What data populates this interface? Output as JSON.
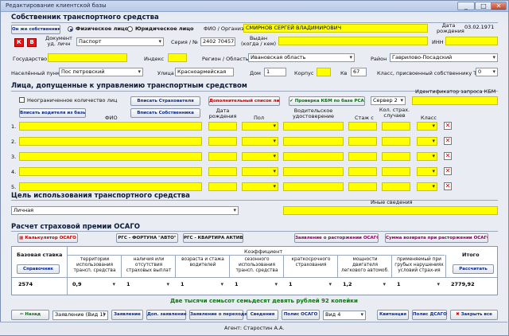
{
  "window": {
    "title": "Редактирование клиентской базы",
    "buttons": [
      "_",
      "□",
      "✕"
    ]
  },
  "owner": {
    "section_title": "Собственник транспортного средства",
    "own_button": "Он же собственник",
    "radio_physical": "Физическое лицо",
    "radio_legal": "Юридическое лицо",
    "fio_label": "ФИО / Организация",
    "fio_value": "СМИРНОВ СЕРГЕЙ ВЛАДИМИРОВИЧ",
    "birth_label": "Дата рождения",
    "birth_value": "03.02.1971",
    "k_button": "К",
    "b_button": "В",
    "doc_label": "Документ уд. личн",
    "doc_value": "Паспорт",
    "series_label": "Серия / №",
    "series_value": "2402 704575",
    "issued_label": "Выдан (когда / кем)",
    "inn_label": "ИНН",
    "state_label": "Государство",
    "index_label": "Индекс",
    "region_label": "Регион / Область",
    "region_value": "Ивановская область",
    "district_label": "Район",
    "district_value": "Гаврилово-Посадский",
    "locality_label": "Населённый пункт",
    "locality_value": "Пос петровский",
    "street_label": "Улица",
    "street_value": "Красноармейская",
    "house_label": "Дом",
    "house_value": "1",
    "corp_label": "Корпус",
    "apt_label": "Кв",
    "apt_value": "67",
    "class_label": "Класс, присвоенный собственнику ТС",
    "class_value": "0"
  },
  "drivers": {
    "section_title": "Лица, допущенные к управлению транспортным средством",
    "unlimited_label": "Неограниченное количество лиц",
    "insert_from_base": "Вписать водителя из базы",
    "insert_insurer": "Вписать Страхователя",
    "insert_owner": "Вписать Собственника",
    "extra_list": "Дополнительный список лиц",
    "check_kbm": "Проверка КБМ по базе РСА",
    "server_value": "Сервер 2",
    "kbm_id_label": "Идентификатор запроса КБМ",
    "col_fio": "ФИО",
    "col_birth": "Дата рождения",
    "col_sex": "Пол",
    "col_license": "Водительское удостоверение",
    "col_exp": "Стаж с",
    "col_cases": "Кол. страх. случаев",
    "col_class": "Класс",
    "rows": [
      "1.",
      "2.",
      "3.",
      "4.",
      "5."
    ]
  },
  "purpose": {
    "section_title": "Цель использования транспортного средства",
    "value": "Личная",
    "other_label": "Иные сведения"
  },
  "premium": {
    "section_title": "Расчет страховой премии ОСАГО",
    "calc_button": "Калькулятор ОСАГО",
    "rgs_fortuna": "РГС - ФОРТУНА \"АВТО\"",
    "rgs_apartment": "РГС - КВАРТИРА АКТИВ",
    "termination_app": "Заявление о расторжении ОСАГО",
    "termination_sum": "Сумма возврата при расторжении ОСАГО",
    "base_rate_label": "Базовая ставка",
    "reference_button": "Справочник",
    "coef_label": "Коэффициент",
    "coefs": [
      "территории использования трансп. средства",
      "наличия или отсутствия страховых выплат",
      "возраста и стажа водителей",
      "сезонного использования трансп. средства",
      "краткосрочного страхования",
      "мощности двигателя легкового автомоб.",
      "применяемый при грубых нарушениях условий страх-ия"
    ],
    "total_label": "Итого",
    "calculate_button": "Рассчитать",
    "base_rate_value": "2574",
    "coef_values": [
      "0,9",
      "1",
      "1",
      "1",
      "1",
      "1,2",
      "1"
    ],
    "total_value": "2779,92",
    "words": "Две тысячи семьсот семьдесят девять рублей 92 копейки"
  },
  "footer": {
    "back": "Назад",
    "statement_select": "Заявление (Вид 1)",
    "statement": "Заявление",
    "add_statement": "Доп. заявление",
    "transfer": "Заявление о переходе",
    "info": "Сведения",
    "policy": "Полис ОСАГО",
    "kind": "Вид 4",
    "receipt": "Квитанция",
    "policy_dsago": "Полис ДСАГО",
    "close_all": "Закрыть все",
    "agent": "Агент: Старостин А.А."
  }
}
